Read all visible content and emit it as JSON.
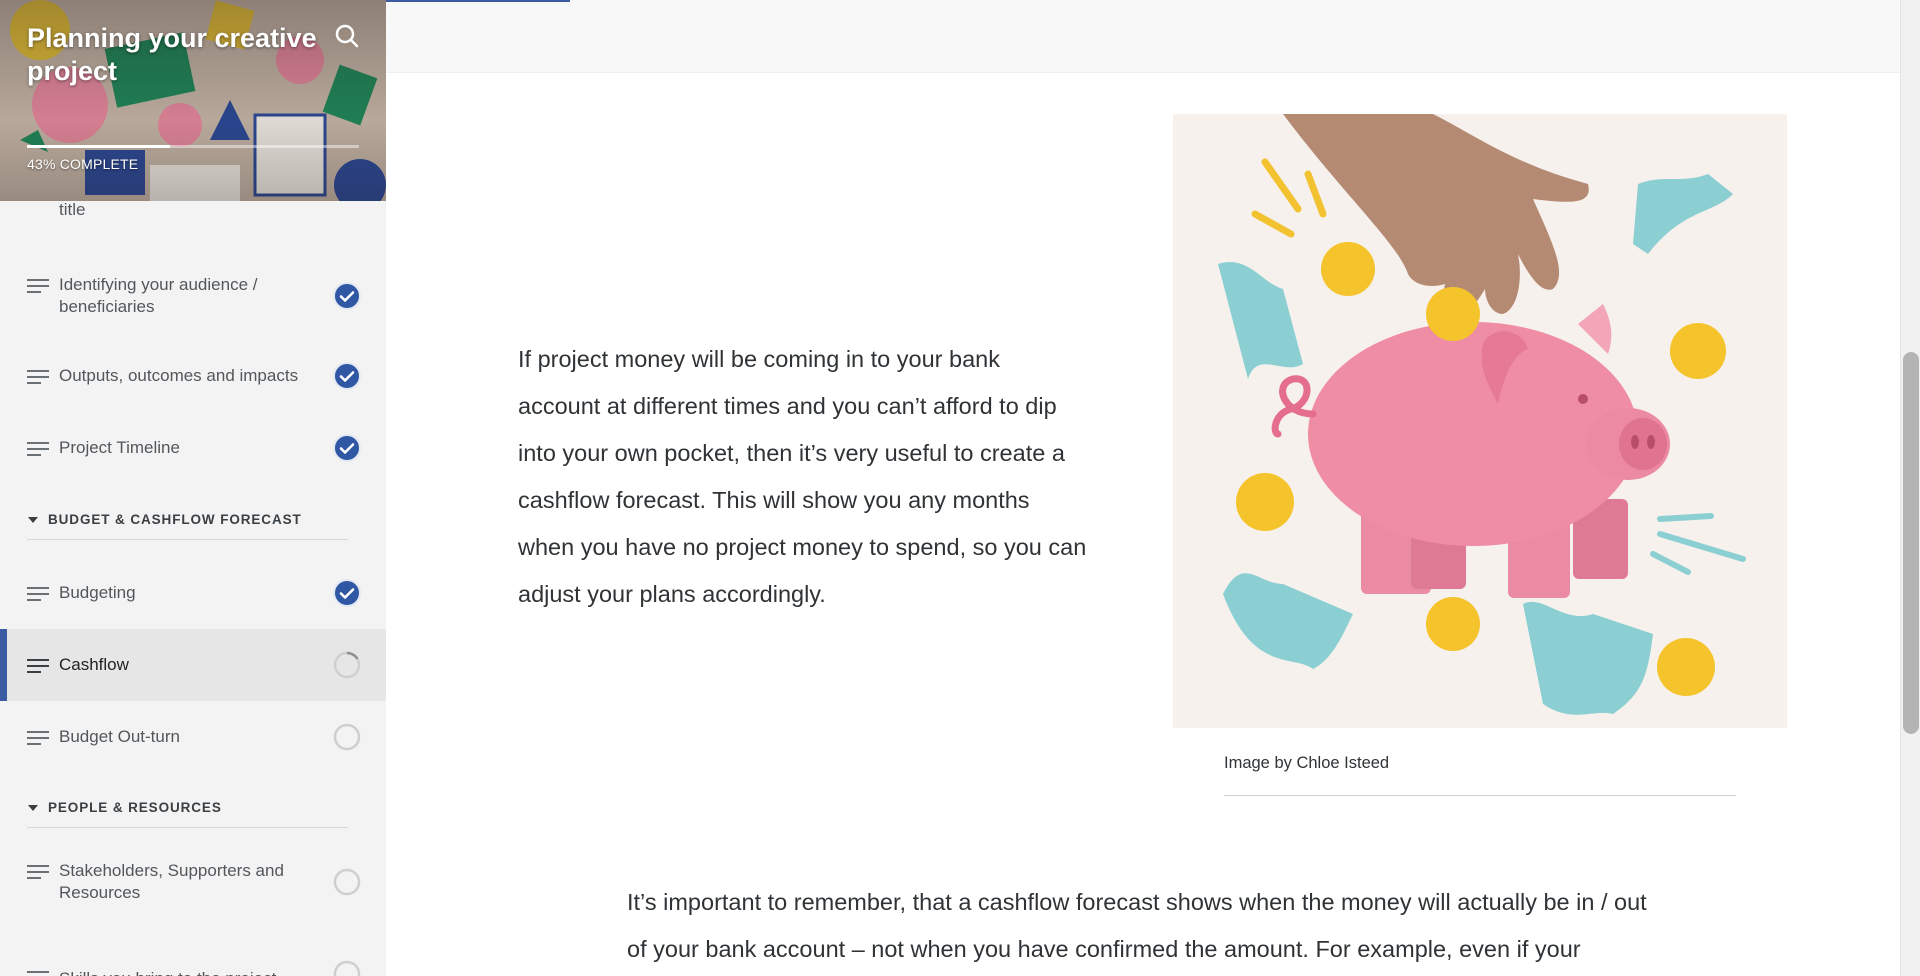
{
  "course": {
    "title": "Planning your creative project",
    "progress_percent": 43,
    "progress_label": "43% COMPLETE"
  },
  "sidebar": {
    "partial_item_tail": "title",
    "sections": [
      {
        "label": "BUDGET & CASHFLOW FORECAST"
      },
      {
        "label": "PEOPLE & RESOURCES"
      }
    ],
    "lessons": [
      {
        "label": "Identifying your audience / beneficiaries",
        "status": "complete"
      },
      {
        "label": "Outputs, outcomes and impacts",
        "status": "complete"
      },
      {
        "label": "Project Timeline",
        "status": "complete"
      },
      {
        "label": "Budgeting",
        "status": "complete"
      },
      {
        "label": "Cashflow",
        "status": "in-progress"
      },
      {
        "label": "Budget Out-turn",
        "status": "not-started"
      },
      {
        "label": "Stakeholders, Supporters and Resources",
        "status": "not-started"
      },
      {
        "label": "Skills you bring to the project",
        "status": "not-started"
      }
    ]
  },
  "content": {
    "paragraph_1": "If project money will be coming in to your bank account at different times and you can’t afford to dip into your own pocket, then it’s very useful to create a cashflow forecast. This will show you any months when you have no project money to spend, so you can adjust your plans accordingly.",
    "image_caption": "Image by Chloe Isteed",
    "paragraph_2": "It’s important to remember, that a cashflow forecast shows when the money will actually be in / out of your bank account – not when you have confirmed the amount. For example, even if your"
  },
  "colors": {
    "accent": "#3b5ba5",
    "check_fill": "#2f57a4",
    "pig": "#ec7f99",
    "coin": "#f5c32b",
    "note": "#8ccfd3"
  }
}
